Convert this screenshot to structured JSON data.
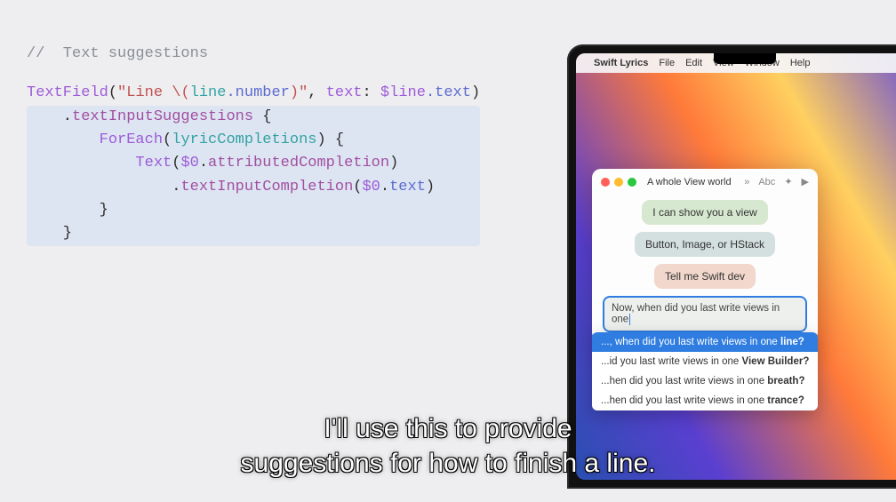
{
  "code": {
    "comment": "//  Text suggestions",
    "l1_a": "TextField",
    "l1_b": "(",
    "l1_c": "\"Line ",
    "l1_d": "\\(",
    "l1_e": "line",
    "l1_f": ".number",
    "l1_g": ")",
    "l1_h": "\"",
    "l1_i": ", ",
    "l1_j": "text",
    "l1_k": ": ",
    "l1_l": "$line",
    "l1_m": ".text",
    "l1_n": ")",
    "l2_a": "    .",
    "l2_b": "textInputSuggestions",
    "l2_c": " {",
    "l3_a": "        ",
    "l3_b": "ForEach",
    "l3_c": "(",
    "l3_d": "lyricCompletions",
    "l3_e": ") {",
    "l4_a": "            ",
    "l4_b": "Text",
    "l4_c": "(",
    "l4_d": "$0",
    "l4_e": ".",
    "l4_f": "attributedCompletion",
    "l4_g": ")",
    "l5_a": "                .",
    "l5_b": "textInputCompletion",
    "l5_c": "(",
    "l5_d": "$0",
    "l5_e": ".",
    "l5_f": "text",
    "l5_g": ")",
    "l6": "        }",
    "l7": "    }"
  },
  "menubar": {
    "app": "Swift Lyrics",
    "items": [
      "File",
      "Edit",
      "View",
      "Window",
      "Help"
    ]
  },
  "window": {
    "title": "A whole View world",
    "icons": {
      "chev": "»",
      "abc": "Abc",
      "sparkle": "✦",
      "play": "▶"
    }
  },
  "lyrics": {
    "l1": "I can show you a view",
    "l2": "Button, Image, or HStack",
    "l3": "Tell me Swift dev",
    "input": "Now, when did you last write views in one"
  },
  "suggestions": [
    {
      "pre": "..., when did you last write views in one ",
      "bold": "line?"
    },
    {
      "pre": "...id you last write views in one ",
      "bold": "View Builder?"
    },
    {
      "pre": "...hen did you last write views in one ",
      "bold": "breath?"
    },
    {
      "pre": "...hen did you last write views in one ",
      "bold": "trance?"
    }
  ],
  "caption": {
    "l1": "I'll use this to provide",
    "l2": "suggestions for how to finish a line."
  }
}
